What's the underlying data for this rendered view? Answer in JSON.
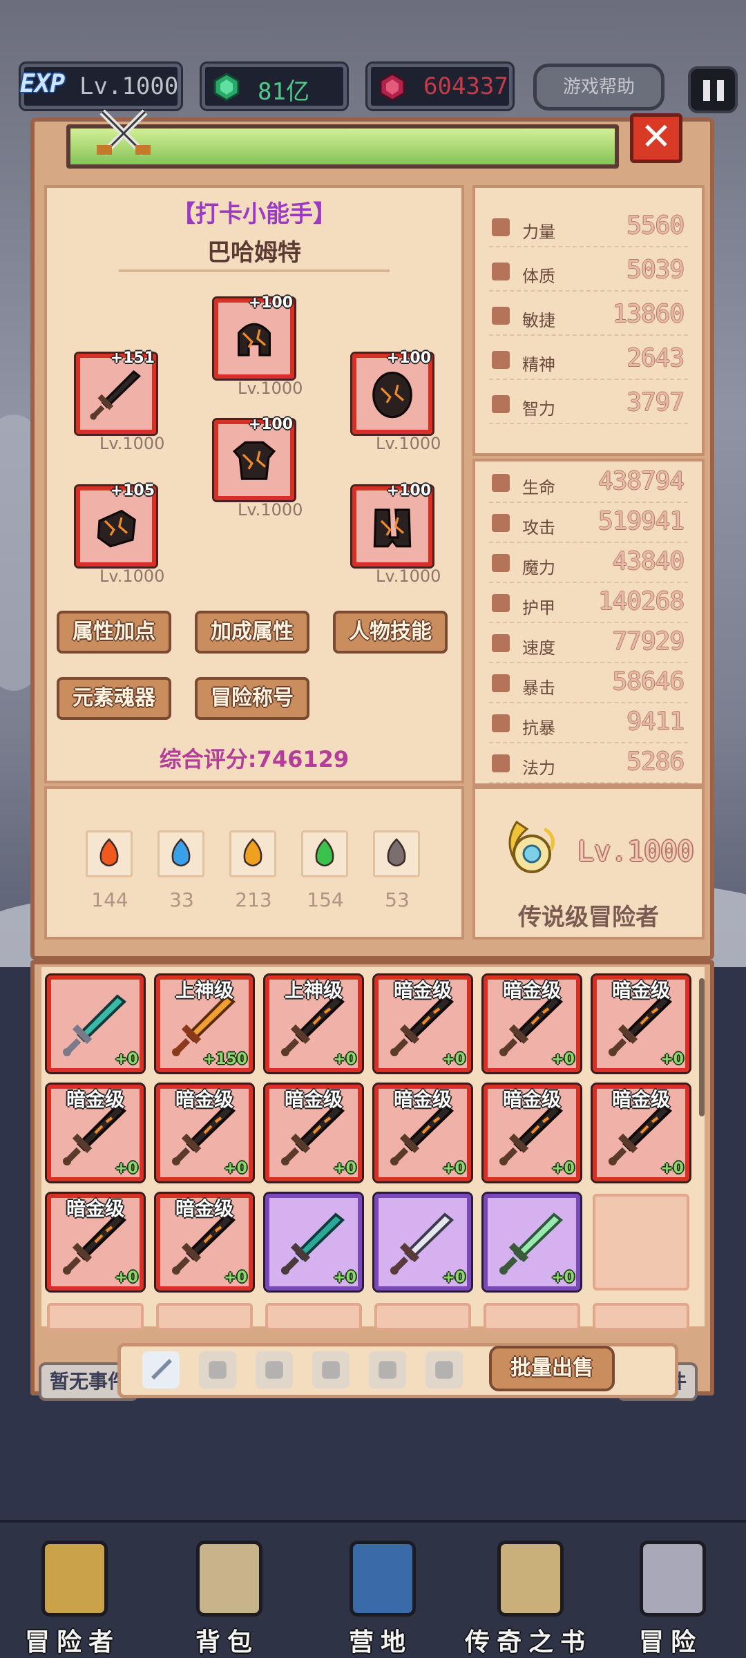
{
  "topbar": {
    "exp_label": "EXP",
    "level": "Lv.1000",
    "gems_green": "81亿",
    "gems_red": "604337",
    "help_label": "游戏帮助"
  },
  "hero": {
    "title": "【打卡小能手】",
    "name": "巴哈姆特",
    "equipment": [
      {
        "slot": "weapon",
        "enhance": "+151",
        "level": "Lv.1000"
      },
      {
        "slot": "helmet",
        "enhance": "+100",
        "level": "Lv.1000"
      },
      {
        "slot": "shield",
        "enhance": "+100",
        "level": "Lv.1000"
      },
      {
        "slot": "armor",
        "enhance": "+100",
        "level": "Lv.1000"
      },
      {
        "slot": "gloves",
        "enhance": "+105",
        "level": "Lv.1000"
      },
      {
        "slot": "boots",
        "enhance": "+100",
        "level": "Lv.1000"
      }
    ],
    "buttons": [
      "属性加点",
      "加成属性",
      "人物技能",
      "元素魂器",
      "冒险称号"
    ],
    "score_label": "综合评分:746129"
  },
  "base_stats": [
    {
      "label": "力量",
      "value": "5560"
    },
    {
      "label": "体质",
      "value": "5039"
    },
    {
      "label": "敏捷",
      "value": "13860"
    },
    {
      "label": "精神",
      "value": "2643"
    },
    {
      "label": "智力",
      "value": "3797"
    }
  ],
  "combat_stats": [
    {
      "label": "生命",
      "value": "438794"
    },
    {
      "label": "攻击",
      "value": "519941"
    },
    {
      "label": "魔力",
      "value": "43840"
    },
    {
      "label": "护甲",
      "value": "140268"
    },
    {
      "label": "速度",
      "value": "77929"
    },
    {
      "label": "暴击",
      "value": "58646"
    },
    {
      "label": "抗暴",
      "value": "9411"
    },
    {
      "label": "法力",
      "value": "5286"
    }
  ],
  "elements": [
    {
      "icon": "fire-gem-icon",
      "value": "144"
    },
    {
      "icon": "water-gem-icon",
      "value": "33"
    },
    {
      "icon": "thunder-gem-icon",
      "value": "213"
    },
    {
      "icon": "wood-gem-icon",
      "value": "154"
    },
    {
      "icon": "dark-gem-icon",
      "value": "53"
    }
  ],
  "rank": {
    "level": "Lv.1000",
    "title": "传说级冒险者"
  },
  "inventory": [
    {
      "grade": "",
      "enhance": "+0",
      "rarity": "red",
      "icon": "teal-sword-icon"
    },
    {
      "grade": "上神级",
      "enhance": "+150",
      "rarity": "red",
      "icon": "golden-sword-icon"
    },
    {
      "grade": "上神级",
      "enhance": "+0",
      "rarity": "red",
      "icon": "dark-sword-icon"
    },
    {
      "grade": "暗金级",
      "enhance": "+0",
      "rarity": "red",
      "icon": "dark-sword-icon"
    },
    {
      "grade": "暗金级",
      "enhance": "+0",
      "rarity": "red",
      "icon": "dark-sword-icon"
    },
    {
      "grade": "暗金级",
      "enhance": "+0",
      "rarity": "red",
      "icon": "dark-sword-icon"
    },
    {
      "grade": "暗金级",
      "enhance": "+0",
      "rarity": "red",
      "icon": "dark-sword-icon"
    },
    {
      "grade": "暗金级",
      "enhance": "+0",
      "rarity": "red",
      "icon": "dark-sword-icon"
    },
    {
      "grade": "暗金级",
      "enhance": "+0",
      "rarity": "red",
      "icon": "dark-sword-icon"
    },
    {
      "grade": "暗金级",
      "enhance": "+0",
      "rarity": "red",
      "icon": "dark-sword-icon"
    },
    {
      "grade": "暗金级",
      "enhance": "+0",
      "rarity": "red",
      "icon": "dark-sword-icon"
    },
    {
      "grade": "暗金级",
      "enhance": "+0",
      "rarity": "red",
      "icon": "dark-sword-icon"
    },
    {
      "grade": "暗金级",
      "enhance": "+0",
      "rarity": "red",
      "icon": "dark-sword-icon"
    },
    {
      "grade": "暗金级",
      "enhance": "+0",
      "rarity": "red",
      "icon": "dark-sword-icon"
    },
    {
      "grade": "",
      "enhance": "+0",
      "rarity": "purple",
      "icon": "teal-greatsword-icon"
    },
    {
      "grade": "",
      "enhance": "+0",
      "rarity": "purple",
      "icon": "steel-sword-icon"
    },
    {
      "grade": "",
      "enhance": "+0",
      "rarity": "purple",
      "icon": "jade-scimitar-icon"
    },
    {
      "grade": "",
      "enhance": "",
      "rarity": "empty",
      "icon": ""
    }
  ],
  "inventory_tabs": [
    "weapon-tab-icon",
    "armor-tab-icon",
    "helmet-tab-icon",
    "gloves-tab-icon",
    "pants-tab-icon",
    "ring-tab-icon"
  ],
  "sell_label": "批量出售",
  "events": {
    "left": "暂无事件",
    "right": "无事件"
  },
  "nav": [
    {
      "label": "冒险者",
      "icon": "adventurer-helmet-icon"
    },
    {
      "label": "背包",
      "icon": "backpack-icon"
    },
    {
      "label": "营地",
      "icon": "camp-banner-icon"
    },
    {
      "label": "传奇之书",
      "icon": "legend-book-icon"
    },
    {
      "label": "冒险",
      "icon": "adventure-sword-icon"
    }
  ],
  "colors": {
    "frame": "#d6a883",
    "panel": "#f4ddbf",
    "red_slot": "#d93025",
    "purple_slot": "#7a48b8",
    "title_purple": "#9b3ac4"
  }
}
